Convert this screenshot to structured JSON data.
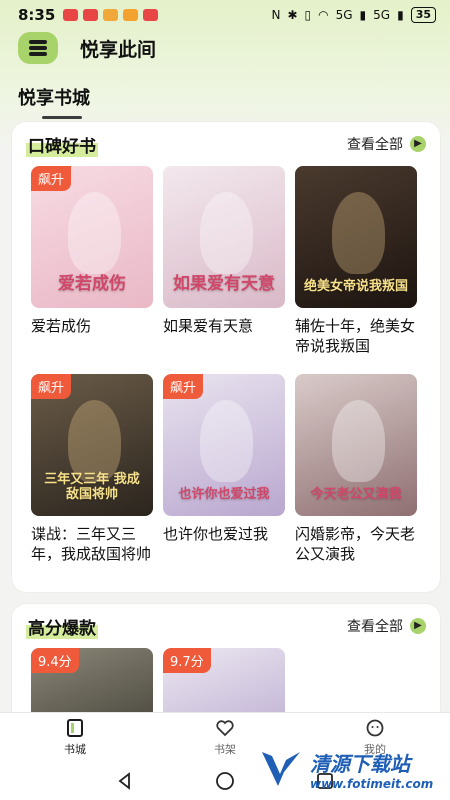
{
  "status_bar": {
    "time": "8:35",
    "signal_1": "5G",
    "signal_2": "5G",
    "battery": "35",
    "notification_colors": [
      "#e84545",
      "#e84545",
      "#f0a83a",
      "#f3a22f",
      "#e84545"
    ]
  },
  "header": {
    "app_title": "悦享此间",
    "logo_color": "#a8d26a"
  },
  "tab": {
    "label": "悦享书城"
  },
  "section_reputation": {
    "title": "口碑好书",
    "see_all": "查看全部",
    "books": [
      {
        "name": "爱若成伤",
        "badge": "飙升",
        "cover_text": "爱若成伤",
        "cover_colors": [
          "#f7dbe3",
          "#e9b8c6"
        ]
      },
      {
        "name": "如果爱有天意",
        "badge": "",
        "cover_text": "如果爱有天意",
        "cover_colors": [
          "#f3e8ee",
          "#d9b9c7"
        ]
      },
      {
        "name": "辅佐十年，绝美女帝说我叛国",
        "badge": "",
        "cover_text": "绝美女帝说我叛国",
        "cover_colors": [
          "#4a3a2e",
          "#1d1410"
        ]
      },
      {
        "name": "谍战：三年又三年，我成敌国将帅",
        "badge": "飙升",
        "cover_text": "三年又三年 我成敌国将帅",
        "cover_colors": [
          "#6b5c48",
          "#2b251e"
        ]
      },
      {
        "name": "也许你也爱过我",
        "badge": "飙升",
        "cover_text": "也许你也爱过我",
        "cover_colors": [
          "#e9e4ef",
          "#b9a7cf"
        ]
      },
      {
        "name": "闪婚影帝，今天老公又演我",
        "badge": "",
        "cover_text": "今天老公又演我",
        "cover_colors": [
          "#d9cbc9",
          "#8f6f72"
        ]
      }
    ]
  },
  "section_high_score": {
    "title": "高分爆款",
    "see_all": "查看全部",
    "books": [
      {
        "score": "9.4分",
        "cover_colors": [
          "#8b8778",
          "#4d4a40"
        ]
      },
      {
        "score": "9.7分",
        "cover_colors": [
          "#ece8f1",
          "#c3b5d6"
        ]
      }
    ]
  },
  "bottom_nav": {
    "items": [
      {
        "label": "书城",
        "icon": "book-city-icon",
        "active": true
      },
      {
        "label": "书架",
        "icon": "heart-icon",
        "active": false
      },
      {
        "label": "我的",
        "icon": "profile-icon",
        "active": false
      }
    ]
  },
  "watermark": {
    "line1": "清源下载站",
    "line2": "www.fotimeit.com"
  }
}
